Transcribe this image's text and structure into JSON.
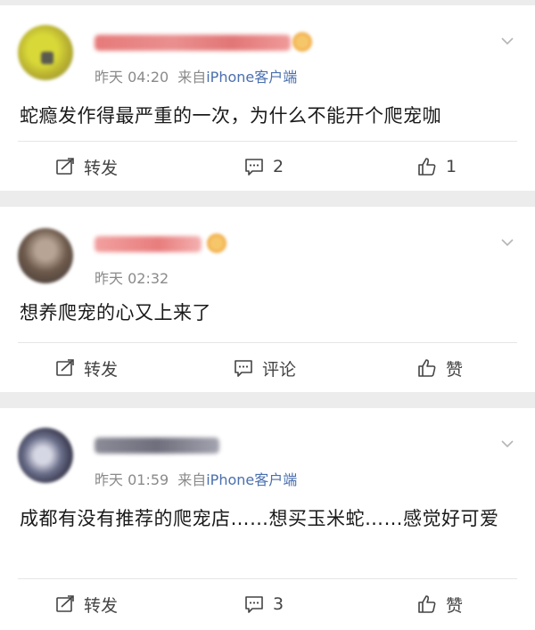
{
  "posts": [
    {
      "time": "昨天 04:20",
      "source_prefix": "来自",
      "device": "iPhone客户端",
      "content": "蛇瘾发作得最严重的一次，为什么不能开个爬宠咖",
      "repost_label": "转发",
      "comment_label": "2",
      "like_label": "1"
    },
    {
      "time": "昨天 02:32",
      "source_prefix": "",
      "device": "",
      "content": "想养爬宠的心又上来了",
      "repost_label": "转发",
      "comment_label": "评论",
      "like_label": "赞"
    },
    {
      "time": "昨天 01:59",
      "source_prefix": "来自",
      "device": "iPhone客户端",
      "content": "成都有没有推荐的爬宠店……想买玉米蛇……感觉好可爱",
      "repost_label": "转发",
      "comment_label": "3",
      "like_label": "赞"
    }
  ],
  "icons": {
    "repost": "repost-icon",
    "comment": "comment-icon",
    "like": "thumbs-up-icon",
    "menu": "chevron-down-icon"
  },
  "colors": {
    "background": "#ececec",
    "card": "#ffffff",
    "meta_text": "#8a8a8a",
    "source_link": "#4a6fae",
    "body_text": "#1a1a1a"
  }
}
